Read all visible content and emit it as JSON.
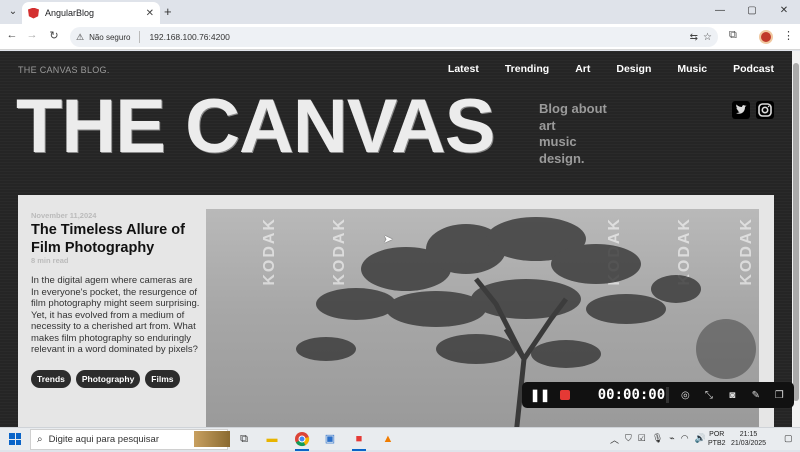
{
  "browser": {
    "tab_title": "AngularBlog",
    "tab_close": "✕",
    "new_tab": "+",
    "window_controls": [
      "—",
      "▢",
      "✕"
    ],
    "not_secure_label": "Não seguro",
    "url": "192.168.100.76:4200"
  },
  "site": {
    "brand": "THE CANVAS BLOG.",
    "nav": [
      "Latest",
      "Trending",
      "Art",
      "Design",
      "Music",
      "Podcast"
    ],
    "hero_title": "THE CANVAS",
    "tagline": [
      "Blog about",
      "art",
      "music",
      "design."
    ],
    "socials": [
      "twitter-icon",
      "instagram-icon"
    ]
  },
  "post": {
    "date": "November 11,2024",
    "title": "The Timeless Allure of Film Photography",
    "read_time": "8 min read",
    "excerpt": "In the digital agem where cameras are In everyone's pocket, the resurgence of film photography might seem surprising. Yet, it has evolved from a medium of necessity to a cherished art from. What makes film photography so enduringly relevant in a word dominated by pixels?",
    "tags": [
      "Trends",
      "Photography",
      "Films"
    ],
    "image_watermark": "KODAK"
  },
  "recorder": {
    "time": "00:00:00"
  },
  "taskbar": {
    "search_placeholder": "Digite aqui para pesquisar",
    "lang_top": "POR",
    "lang_bottom": "PTB2",
    "time": "21:15",
    "date": "21/03/2025"
  },
  "colors": {
    "page_bg": "#252525",
    "card_bg": "#e6e6e6",
    "record_red": "#e53935"
  }
}
